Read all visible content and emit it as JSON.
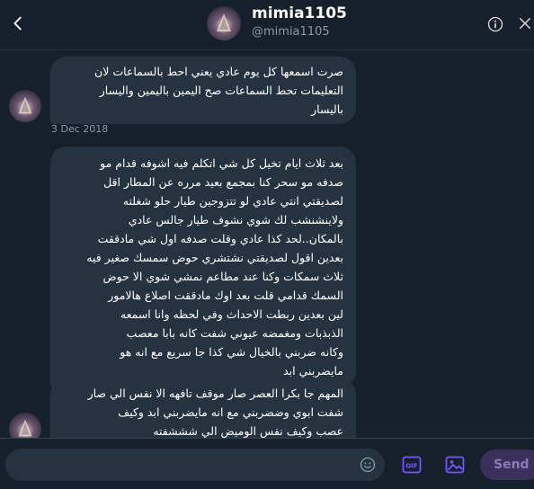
{
  "header": {
    "display_name": "mimia1105",
    "handle": "@mimia1105",
    "back_icon": "chevron-left-icon",
    "info_icon": "info-icon",
    "close_icon": "close-icon"
  },
  "messages": [
    {
      "text": "صرت اسمعها كل يوم عادي يعني احط بالسماعات لان\nالتعليمات تحط السماعات صح اليمين باليمين واليسار\nباليسار"
    },
    {
      "text": "بعد ثلاث ايام تخيل كل شي اتكلم فيه اشوفه قدام مو\nصدفه مو سحر كنا بمجمع بعيد مرره عن المطار اقل\nلصديقتي انتي عادي لو تتزوجين طيار حلو شغلته\nولاينشنشب لك شوي نشوف طيار جالس عادي\nبالمكان..لحد كذا عادي وقلت صدفه اول شي مادققت\nبعدين اقول لصديقتي نشتشري حوض سمسك صغير فيه\nثلاث سمكات وكنا عند مطاعم  نمشي شوي الا حوض\nالسمك قدامي قلت بعد اوك مادققت اصلاع هالامور\nلين بعدين ربطت الاحداث وفي لحظه وانا اسمعه\nالذبذبات ومغمضه عيوني شفت كانه بابا معصب\nوكانه ضربني بالخيال شي كذا جا سريع مع انه هو\nمايضربني ابد"
    },
    {
      "text": "المهم جا بكرا العصر صار موقف تافهه الا نفس الي صار\nشفت ابوي وضضربني مع انه مايضربني ابد وكيف\nعصب وكيف نفس الوميض الي شششفته"
    }
  ],
  "timestamp": "3 Dec 2018",
  "composer": {
    "placeholder": "",
    "emoji_icon": "emoji-icon",
    "gif_label": "GIF",
    "media_icon": "image-icon",
    "send_label": "Send"
  },
  "colors": {
    "background": "#15202b",
    "bubble": "#253341",
    "accent": "#7856ff",
    "muted": "#8899a6"
  }
}
